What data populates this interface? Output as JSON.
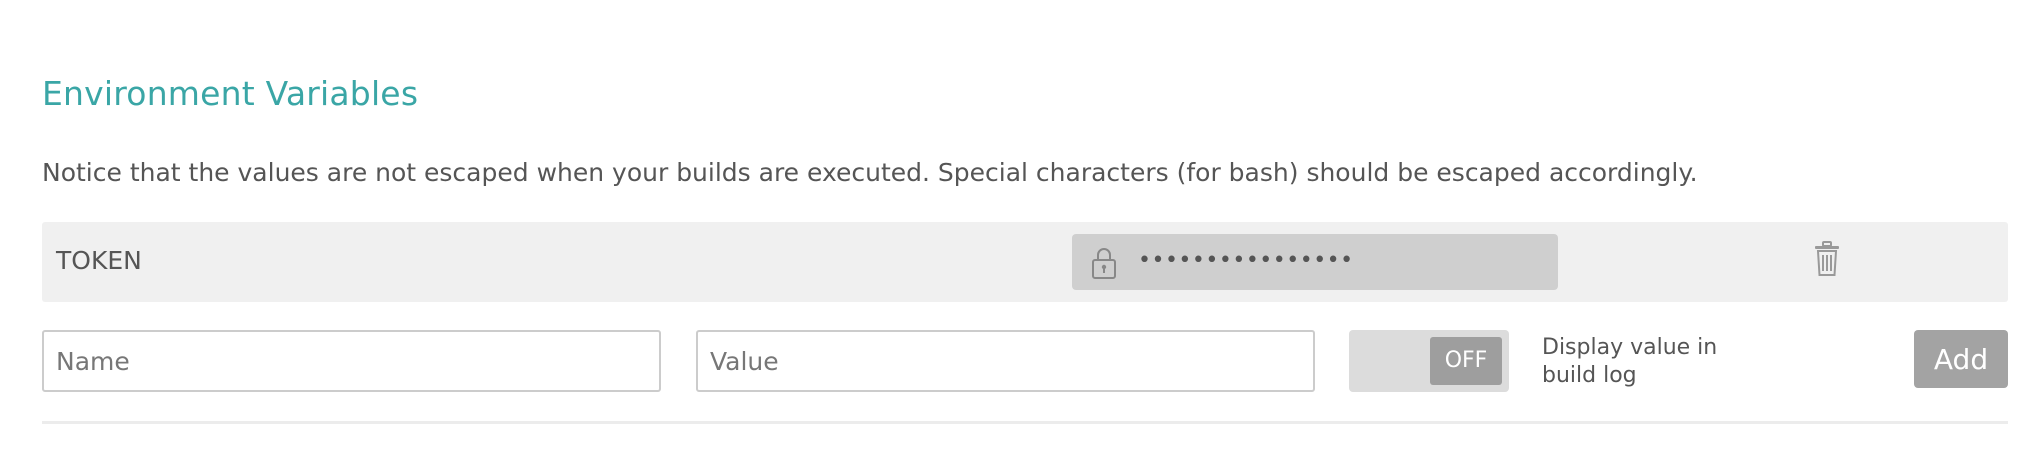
{
  "section": {
    "title": "Environment Variables",
    "notice": "Notice that the values are not escaped when your builds are executed. Special characters (for bash) should be escaped accordingly."
  },
  "variables": [
    {
      "name": "TOKEN",
      "value_masked": "••••••••••••••••",
      "lock_icon": "lock-icon",
      "delete_icon": "trash-icon"
    }
  ],
  "new_variable": {
    "name_placeholder": "Name",
    "name_value": "",
    "value_placeholder": "Value",
    "value_value": "",
    "toggle_state": "OFF",
    "toggle_label": "Display value in build log",
    "add_label": "Add"
  },
  "colors": {
    "title": "#3aa6a6",
    "row_bg": "#f0f0f0",
    "secret_bg": "#cfcfcf",
    "button_bg": "#a3a3a3"
  }
}
